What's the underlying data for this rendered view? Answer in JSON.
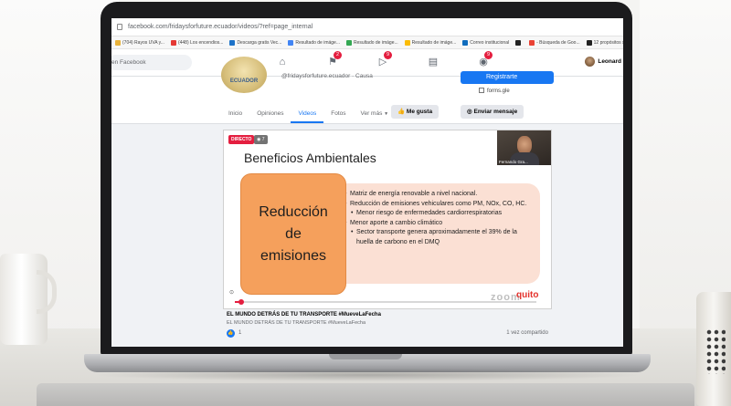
{
  "browser": {
    "url": "facebook.com/fridaysforfuture.ecuador/videos/?ref=page_internal",
    "bookmarks": [
      {
        "label": "(704) Rayos UVA y...",
        "icon": "bookmark-icon",
        "color": "#e8b23a"
      },
      {
        "label": "(448) Los encendios...",
        "icon": "youtube-icon",
        "color": "#e53935"
      },
      {
        "label": "Descarga gratis Vec...",
        "icon": "freepik-icon",
        "color": "#1d73c9"
      },
      {
        "label": "Resultado de imáge...",
        "icon": "google-icon",
        "color": "#4285f4"
      },
      {
        "label": "Resultado de imáge...",
        "icon": "google-icon",
        "color": "#34a853"
      },
      {
        "label": "Resultado de imáge...",
        "icon": "google-icon",
        "color": "#fbbc05"
      },
      {
        "label": "Correo institucional",
        "icon": "outlook-icon",
        "color": "#0f6cbd"
      },
      {
        "label": "",
        "icon": "github-icon",
        "color": "#222222"
      },
      {
        "label": "- Búsqueda de Goo...",
        "icon": "google-icon",
        "color": "#ea4335"
      },
      {
        "label": "12 propósitos sost...",
        "icon": "medium-icon",
        "color": "#222222"
      }
    ]
  },
  "facebook": {
    "search_placeholder": "en Facebook",
    "nav_badges": [
      "",
      "2",
      "9",
      "",
      "9"
    ],
    "user_name": "Leonard",
    "page_handle": "@fridaysforfuture.ecuador · Causa",
    "logo_text": "ECUADOR",
    "register_label": "Registrarte",
    "form_link": "forms.gle",
    "tabs": [
      "Inicio",
      "Opiniones",
      "Videos",
      "Fotos",
      "Ver más"
    ],
    "active_tab": "Videos",
    "like_label": "Me gusta",
    "message_label": "Enviar mensaje"
  },
  "video": {
    "live_label": "DIRECTO",
    "viewers": "7",
    "progress": 0.02,
    "slide_title": "Beneficios Ambientales",
    "highlight_lines": [
      "Reducción",
      "de",
      "emisiones"
    ],
    "bullets": [
      {
        "text": "Matriz de energía renovable a nivel nacional.",
        "sub": false
      },
      {
        "text": "Reducción de emisiones vehiculares como PM, NOx, CO, HC.",
        "sub": false
      },
      {
        "text": "Menor riesgo de enfermedades cardiorrespiratorias",
        "sub": true
      },
      {
        "text": "Menor aporte a cambio climático",
        "sub": false
      },
      {
        "text": "Sector transporte genera aproximadamente el 39% de la huella de carbono en el DMQ",
        "sub": true
      }
    ],
    "camera_name": "Fernando Gra...",
    "zoom_logo": "zoom",
    "quito_logo": "quito"
  },
  "post": {
    "title": "EL MUNDO DETRÁS DE TU TRANSPORTE #MueveLaFecha",
    "subtitle": "EL MUNDO DETRÁS DE TU TRANSPORTE #MueveLaFecha",
    "likes": "1",
    "shares": "1 vez compartido"
  },
  "colors": {
    "facebook_blue": "#1877f2",
    "live_red": "#e41e3f",
    "highlight_orange": "#f5a05c",
    "panel_pink": "#fbe0d4"
  }
}
